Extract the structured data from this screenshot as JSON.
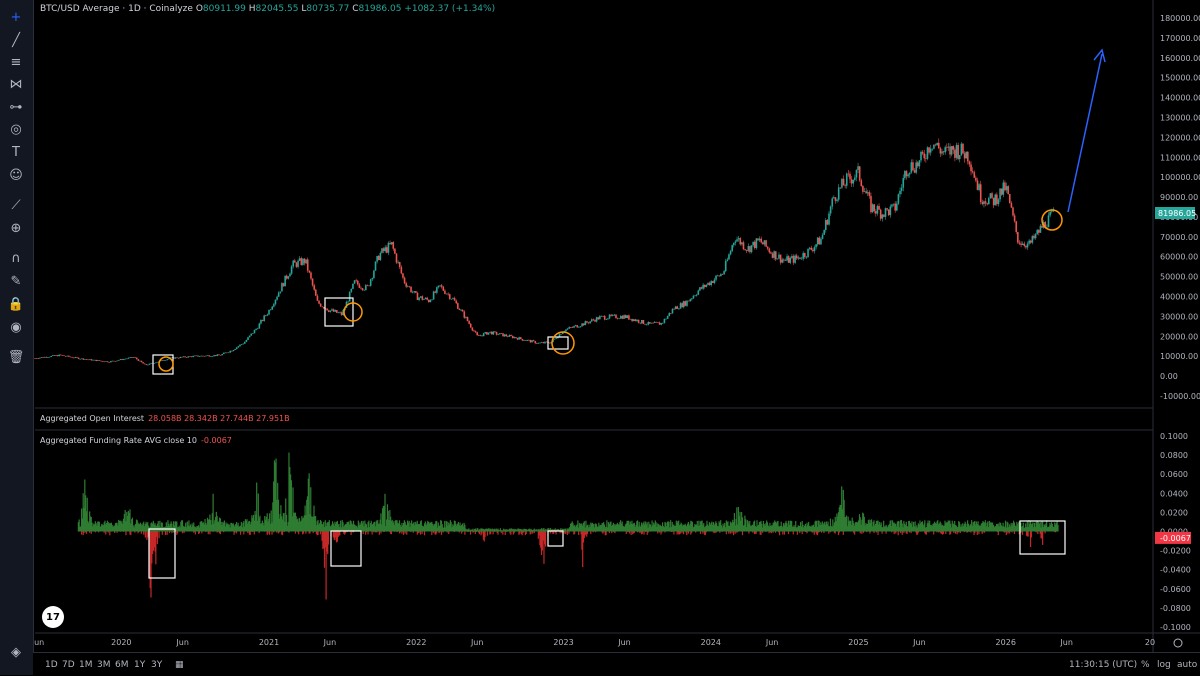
{
  "header": {
    "symbol": "BTC/USD Average · 1D · Coinalyze",
    "open_label": "O",
    "open": "80911.99",
    "high_label": "H",
    "high": "82045.55",
    "low_label": "L",
    "low": "80735.77",
    "close_label": "C",
    "close": "81986.05",
    "change": "+1082.37 (+1.34%)"
  },
  "panes": {
    "oi_label": "Aggregated Open Interest",
    "oi_values": "28.058B  28.342B  27.744B  27.951B",
    "fr_label": "Aggregated Funding Rate AVG close 10",
    "fr_value": "-0.0067"
  },
  "colors": {
    "up": "#26a69a",
    "down": "#ef5350",
    "funding_pos": "#2e7d32",
    "funding_neg": "#c62828",
    "box": "#ffffff",
    "circle": "#ff9800",
    "arrow": "#2962ff",
    "price_badge": "#26a69a",
    "fr_badge": "#f23645"
  },
  "toolbar": {
    "icons": [
      "crosshair-icon",
      "trendline-icon",
      "fib-icon",
      "pattern-icon",
      "measure-icon",
      "brush-icon",
      "text-icon",
      "emoji-icon",
      "ruler-icon",
      "zoom-icon",
      "magnet-icon",
      "lock-draw-icon",
      "lock-icon",
      "eye-icon",
      "trash-icon",
      "layers-icon"
    ]
  },
  "bottombar": {
    "timeframes": [
      "1D",
      "7D",
      "1M",
      "3M",
      "6M",
      "1Y",
      "3Y"
    ],
    "time": "11:30:15 (UTC)",
    "percent": "%",
    "log": "log",
    "auto": "auto"
  },
  "chart_data": [
    {
      "type": "line",
      "title": "BTC/USD Average · 1D · Coinalyze",
      "x_ticks": [
        "Jun",
        "2020",
        "Jun",
        "2021",
        "Jun",
        "2022",
        "Jun",
        "2023",
        "Jun",
        "2024",
        "Jun",
        "2025",
        "Jun",
        "2026",
        "Jun",
        "20"
      ],
      "y_ticks": [
        "180000.00",
        "170000.00",
        "160000.00",
        "150000.00",
        "140000.00",
        "130000.00",
        "120000.00",
        "110000.00",
        "100000.00",
        "90000.00",
        "80000.00",
        "70000.00",
        "60000.00",
        "50000.00",
        "40000.00",
        "30000.00",
        "20000.00",
        "10000.00",
        "0.00",
        "-10000.00"
      ],
      "ylim": [
        -10000,
        180000
      ],
      "last_price": "81986.05",
      "series": [
        {
          "x": [
            "2019-06",
            "2019-08",
            "2019-10",
            "2019-12",
            "2020-02",
            "2020-03",
            "2020-05",
            "2020-07",
            "2020-09",
            "2020-10",
            "2020-11",
            "2020-12",
            "2021-01",
            "2021-02",
            "2021-03",
            "2021-04",
            "2021-05",
            "2021-06",
            "2021-07",
            "2021-08",
            "2021-09",
            "2021-10",
            "2021-11",
            "2021-12",
            "2022-01",
            "2022-02",
            "2022-03",
            "2022-04",
            "2022-05",
            "2022-06",
            "2022-07",
            "2022-09",
            "2022-11",
            "2022-12",
            "2023-01",
            "2023-03",
            "2023-04",
            "2023-06",
            "2023-08",
            "2023-09",
            "2023-10",
            "2023-11",
            "2023-12",
            "2024-02",
            "2024-03",
            "2024-04",
            "2024-05",
            "2024-06",
            "2024-07",
            "2024-08",
            "2024-09",
            "2024-10",
            "2024-11",
            "2024-12",
            "2025-01",
            "2025-02",
            "2025-03",
            "2025-04",
            "2025-05",
            "2025-06",
            "2025-07",
            "2025-08",
            "2025-09",
            "2025-10",
            "2025-11",
            "2025-12",
            "2026-01",
            "2026-02",
            "2026-03",
            "2026-04",
            "2026-05"
          ],
          "y": [
            9000,
            10500,
            8500,
            7200,
            9500,
            5500,
            9000,
            10000,
            10500,
            13000,
            17000,
            24000,
            33000,
            45000,
            56000,
            58000,
            37000,
            33000,
            31000,
            47000,
            44000,
            61000,
            66000,
            48000,
            40000,
            38000,
            45000,
            39000,
            30000,
            20000,
            22000,
            19500,
            16500,
            17000,
            23000,
            27000,
            29500,
            30000,
            26000,
            26500,
            34000,
            37000,
            43000,
            52000,
            70000,
            64000,
            68000,
            62000,
            58000,
            59000,
            63000,
            69000,
            90000,
            98000,
            102000,
            85000,
            82000,
            84000,
            105000,
            107000,
            118000,
            112000,
            114000,
            111000,
            90000,
            88000,
            95000,
            68000,
            66000,
            75000,
            81986
          ]
        }
      ],
      "annotations": {
        "boxes": 4,
        "circles": 5,
        "arrow": "up"
      }
    },
    {
      "type": "bar",
      "title": "Aggregated Funding Rate AVG close 10",
      "y_ticks": [
        "0.1000",
        "0.0800",
        "0.0600",
        "0.0400",
        "0.0200",
        "0.0000",
        "-0.0200",
        "-0.0400",
        "-0.0600",
        "-0.0800",
        "-0.1000"
      ],
      "ylim": [
        -0.1,
        0.1
      ],
      "last_value": "-0.0067"
    }
  ]
}
